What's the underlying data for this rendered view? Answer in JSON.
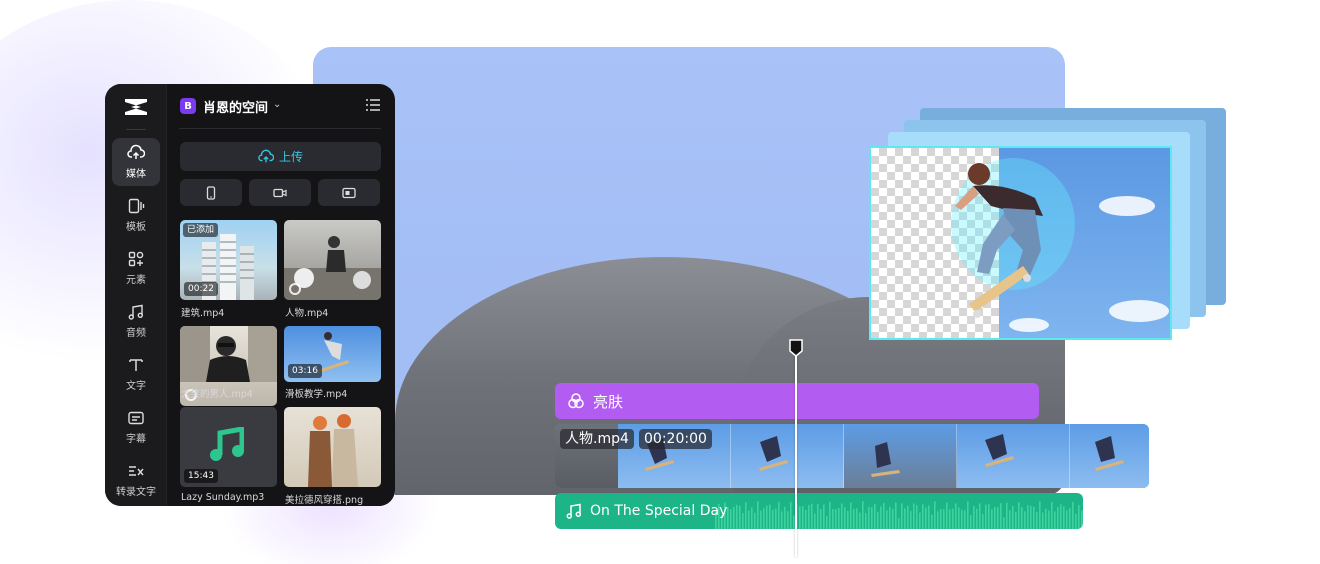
{
  "workspace": {
    "badge": "B",
    "name": "肖恩的空间",
    "chevron": "⌄"
  },
  "sidebar": {
    "items": [
      {
        "label": "媒体",
        "icon": "cloud-upload-icon",
        "active": true
      },
      {
        "label": "模板",
        "icon": "template-icon"
      },
      {
        "label": "元素",
        "icon": "elements-icon"
      },
      {
        "label": "音频",
        "icon": "music-note-icon"
      },
      {
        "label": "文字",
        "icon": "text-icon"
      },
      {
        "label": "字幕",
        "icon": "subtitle-icon"
      },
      {
        "label": "转录文字",
        "icon": "transcribe-icon"
      }
    ]
  },
  "media": {
    "upload_label": "上传",
    "sources": [
      {
        "icon": "phone-icon"
      },
      {
        "icon": "camera-icon"
      },
      {
        "icon": "screen-record-icon"
      }
    ],
    "items": [
      {
        "name": "建筑.mp4",
        "duration": "00:22",
        "tag": "已添加"
      },
      {
        "name": "人物.mp4"
      },
      {
        "name": "大笑的男人.mp4"
      },
      {
        "name": "滑板教学.mp4",
        "duration": "03:16"
      },
      {
        "name": "Lazy Sunday.mp3",
        "duration": "15:43"
      },
      {
        "name": "美拉德风穿搭.png"
      }
    ]
  },
  "timeline": {
    "effect_label": "亮肤",
    "video_name": "人物.mp4",
    "video_duration": "00:20:00",
    "audio_label": "On The Special Day"
  },
  "colors": {
    "effect": "#b35cf2",
    "audio": "#1db487",
    "accent": "#35c7e0",
    "preview_bg": "#a9c3f8"
  }
}
